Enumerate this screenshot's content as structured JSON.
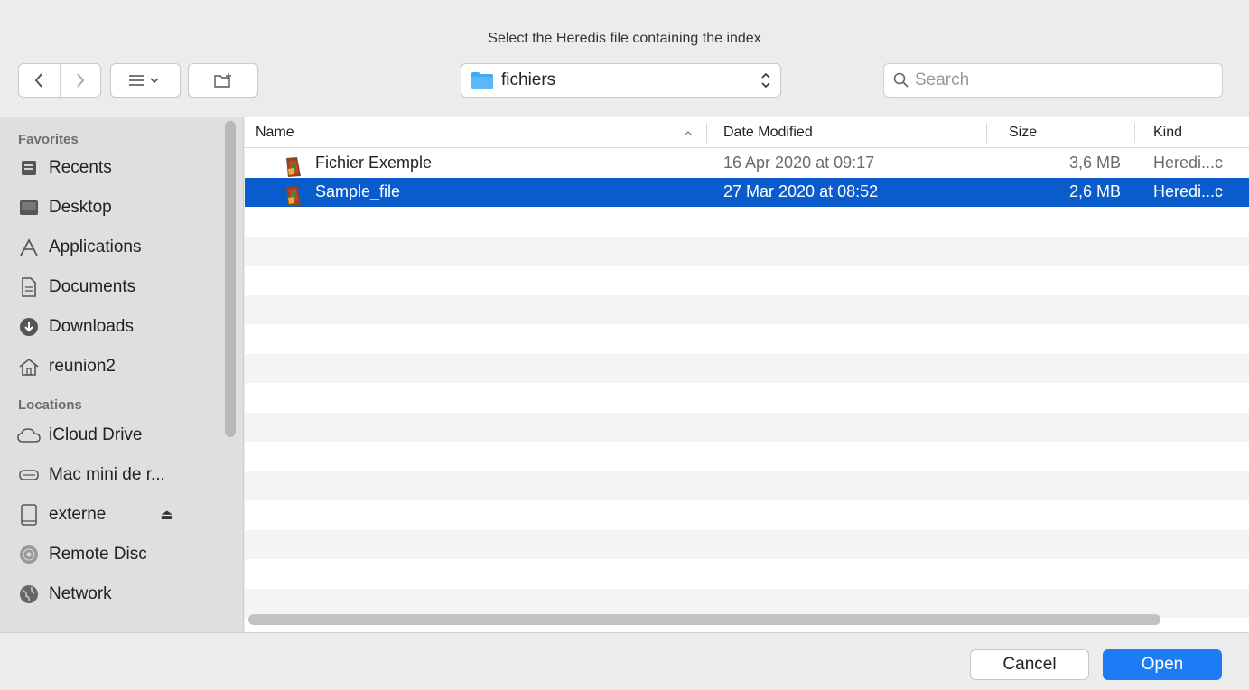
{
  "dialog": {
    "title": "Select the Heredis file containing the index"
  },
  "toolbar": {
    "location": "fichiers",
    "search_placeholder": "Search"
  },
  "sidebar": {
    "favorites_label": "Favorites",
    "favorites": [
      {
        "label": "Recents",
        "icon": "recents-icon"
      },
      {
        "label": "Desktop",
        "icon": "desktop-icon"
      },
      {
        "label": "Applications",
        "icon": "applications-icon"
      },
      {
        "label": "Documents",
        "icon": "documents-icon"
      },
      {
        "label": "Downloads",
        "icon": "downloads-icon"
      },
      {
        "label": "reunion2",
        "icon": "home-icon"
      }
    ],
    "locations_label": "Locations",
    "locations": [
      {
        "label": "iCloud Drive",
        "icon": "cloud-icon"
      },
      {
        "label": "Mac mini de r...",
        "icon": "harddrive-icon"
      },
      {
        "label": "externe",
        "icon": "external-drive-icon"
      },
      {
        "label": "Remote Disc",
        "icon": "disc-icon"
      },
      {
        "label": "Network",
        "icon": "network-icon"
      }
    ]
  },
  "table": {
    "columns": {
      "name": "Name",
      "date": "Date Modified",
      "size": "Size",
      "kind": "Kind"
    },
    "rows": [
      {
        "name": "Fichier Exemple",
        "date": "16 Apr 2020 at 09:17",
        "size": "3,6 MB",
        "kind": "Heredi...c",
        "selected": false
      },
      {
        "name": "Sample_file",
        "date": "27 Mar 2020 at 08:52",
        "size": "2,6 MB",
        "kind": "Heredi...c",
        "selected": true
      }
    ]
  },
  "buttons": {
    "cancel": "Cancel",
    "open": "Open"
  },
  "colors": {
    "accent": "#1d7bf5",
    "selection": "#0a5ccc"
  }
}
